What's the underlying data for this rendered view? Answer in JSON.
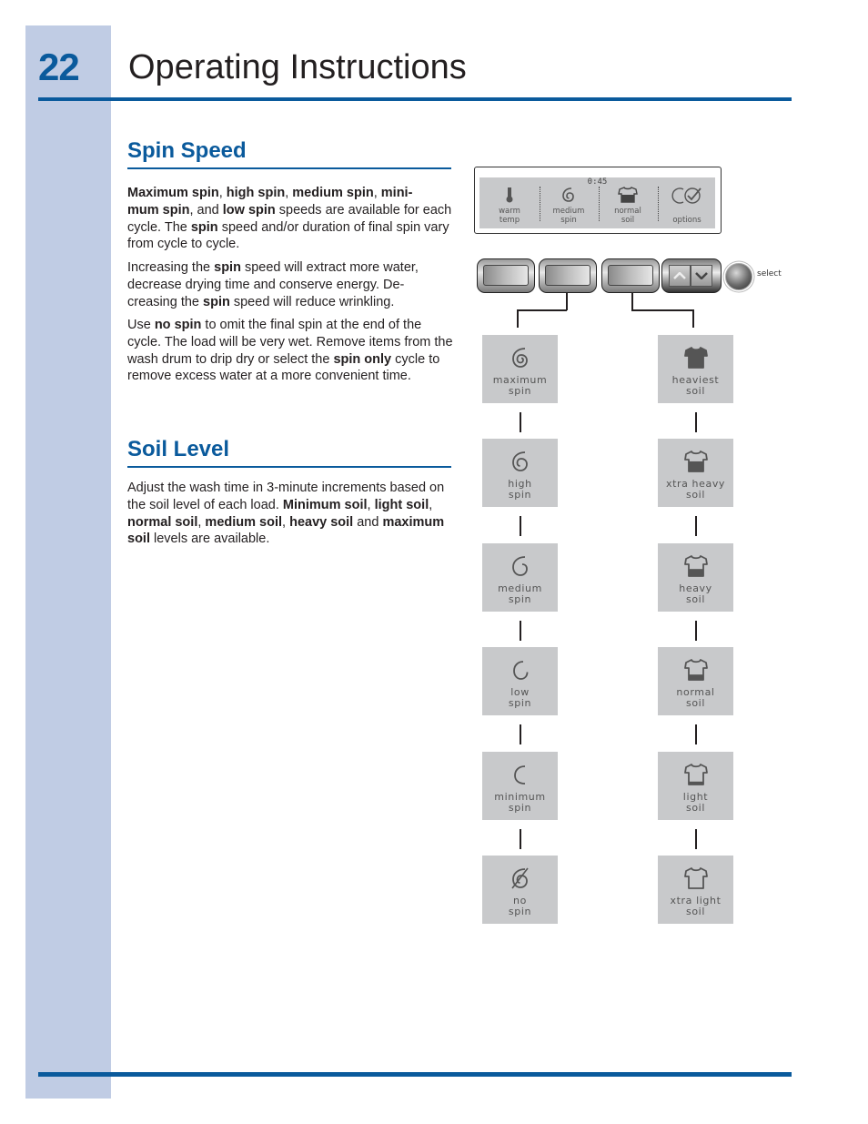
{
  "header": {
    "page_number": "22",
    "title": "Operating Instructions"
  },
  "sections": [
    {
      "title": "Spin Speed",
      "paragraphs": [
        [
          {
            "t": "Maximum spin",
            "b": true
          },
          {
            "t": ", ",
            "b": false
          },
          {
            "t": "high spin",
            "b": true
          },
          {
            "t": ", ",
            "b": false
          },
          {
            "t": "medium spin",
            "b": true
          },
          {
            "t": ", ",
            "b": false
          },
          {
            "t": "mini-\nmum spin",
            "b": true
          },
          {
            "t": ", and ",
            "b": false
          },
          {
            "t": "low spin",
            "b": true
          },
          {
            "t": " speeds are available for each cycle. The ",
            "b": false
          },
          {
            "t": "spin",
            "b": true
          },
          {
            "t": " speed and/or duration of final spin vary from cycle to cycle.",
            "b": false
          }
        ],
        [
          {
            "t": "Increasing the ",
            "b": false
          },
          {
            "t": "spin",
            "b": true
          },
          {
            "t": " speed will extract more water, decrease drying time and conserve energy. De-\ncreasing the ",
            "b": false
          },
          {
            "t": "spin",
            "b": true
          },
          {
            "t": " speed will reduce wrinkling.",
            "b": false
          }
        ],
        [
          {
            "t": "Use ",
            "b": false
          },
          {
            "t": "no spin",
            "b": true
          },
          {
            "t": " to omit the final spin at the end of the cycle. The load will be very wet. Remove items from the wash drum to drip dry or select the ",
            "b": false
          },
          {
            "t": "spin only",
            "b": true
          },
          {
            "t": " cycle to remove excess water at a more convenient time.",
            "b": false
          }
        ]
      ]
    },
    {
      "title": "Soil Level",
      "paragraphs": [
        [
          {
            "t": "Adjust the wash time in 3-minute increments based on the soil level of each load. ",
            "b": false
          },
          {
            "t": "Minimum soil",
            "b": true
          },
          {
            "t": ", ",
            "b": false
          },
          {
            "t": "light soil",
            "b": true
          },
          {
            "t": ", ",
            "b": false
          },
          {
            "t": "normal soil",
            "b": true
          },
          {
            "t": ", ",
            "b": false
          },
          {
            "t": "medium soil",
            "b": true
          },
          {
            "t": ", ",
            "b": false
          },
          {
            "t": "heavy soil",
            "b": true
          },
          {
            "t": " and ",
            "b": false
          },
          {
            "t": "maximum soil",
            "b": true
          },
          {
            "t": " levels are available.",
            "b": false
          }
        ]
      ]
    }
  ],
  "display": {
    "time": "0:45",
    "cells": [
      {
        "icon": "thermometer-icon",
        "line1": "warm",
        "line2": "temp"
      },
      {
        "icon": "spin-icon",
        "line1": "medium",
        "line2": "spin"
      },
      {
        "icon": "shirt-icon",
        "line1": "normal",
        "line2": "soil"
      },
      {
        "icon": "options-icon",
        "line1": "",
        "line2": "options"
      }
    ]
  },
  "controls": {
    "select_label": "select"
  },
  "spin_options": [
    {
      "line1": "maximum",
      "line2": "spin",
      "level": "maximum"
    },
    {
      "line1": "high",
      "line2": "spin",
      "level": "high"
    },
    {
      "line1": "medium",
      "line2": "spin",
      "level": "medium"
    },
    {
      "line1": "low",
      "line2": "spin",
      "level": "low"
    },
    {
      "line1": "minimum",
      "line2": "spin",
      "level": "minimum"
    },
    {
      "line1": "no",
      "line2": "spin",
      "level": "none"
    }
  ],
  "soil_options": [
    {
      "line1": "heaviest",
      "line2": "soil",
      "fill": 1.0
    },
    {
      "line1": "xtra heavy",
      "line2": "soil",
      "fill": 0.85
    },
    {
      "line1": "heavy",
      "line2": "soil",
      "fill": 0.6
    },
    {
      "line1": "normal",
      "line2": "soil",
      "fill": 0.45
    },
    {
      "line1": "light",
      "line2": "soil",
      "fill": 0.25
    },
    {
      "line1": "xtra light",
      "line2": "soil",
      "fill": 0.0
    }
  ],
  "colors": {
    "brand_blue": "#0a5a9c",
    "sidebar": "#c0cce4",
    "tile": "#c8c9cb",
    "icon": "#555555"
  }
}
